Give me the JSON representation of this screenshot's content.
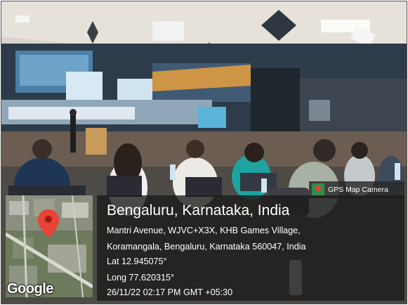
{
  "app": {
    "badge_label": "GPS Map Camera"
  },
  "location": {
    "city": "Bengaluru, Karnataka, India",
    "address_line1": "Mantri Avenue, WJVC+X3X, KHB Games Village,",
    "address_line2": "Koramangala, Bengaluru, Karnataka 560047, India",
    "latitude": "Lat 12.945075°",
    "longitude": "Long 77.620315°",
    "datetime": "26/11/22 02:17 PM GMT +05:30"
  },
  "map": {
    "provider_watermark": "Google",
    "pin_color": "#e84335"
  },
  "colors": {
    "overlay": "#191919",
    "badge_icon": "#2f8f4a"
  },
  "icons": {
    "badge": "gps-map-camera-icon",
    "pin": "map-pin-icon"
  }
}
